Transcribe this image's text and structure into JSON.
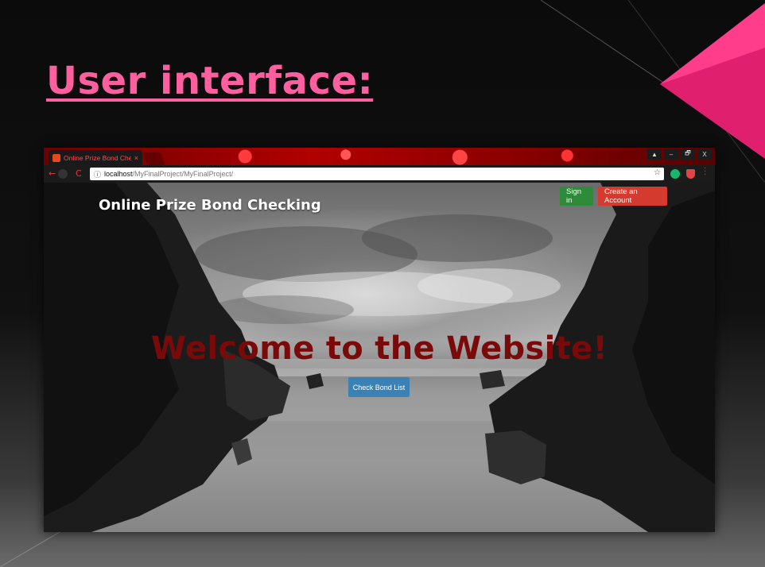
{
  "slide": {
    "title": "User interface:"
  },
  "browser": {
    "tab": {
      "title": "Online Prize Bond Chec",
      "close": "×"
    },
    "window_controls": [
      "–",
      "🗗",
      "X"
    ],
    "address": {
      "host": "localhost",
      "path": "/MyFinalProject/MyFinalProject/"
    }
  },
  "site": {
    "brand": "Online Prize Bond Checking",
    "sign_in": "Sign in",
    "create_account": "Create an Account",
    "hero_title": "Welcome to the Website!",
    "check_bond": "Check Bond List"
  },
  "colors": {
    "title_pink": "#ff5f9e",
    "signin_green": "#2e8b3a",
    "create_red": "#d43a2e",
    "hero_red": "#7a0a0a",
    "check_blue": "#3a82b6"
  }
}
